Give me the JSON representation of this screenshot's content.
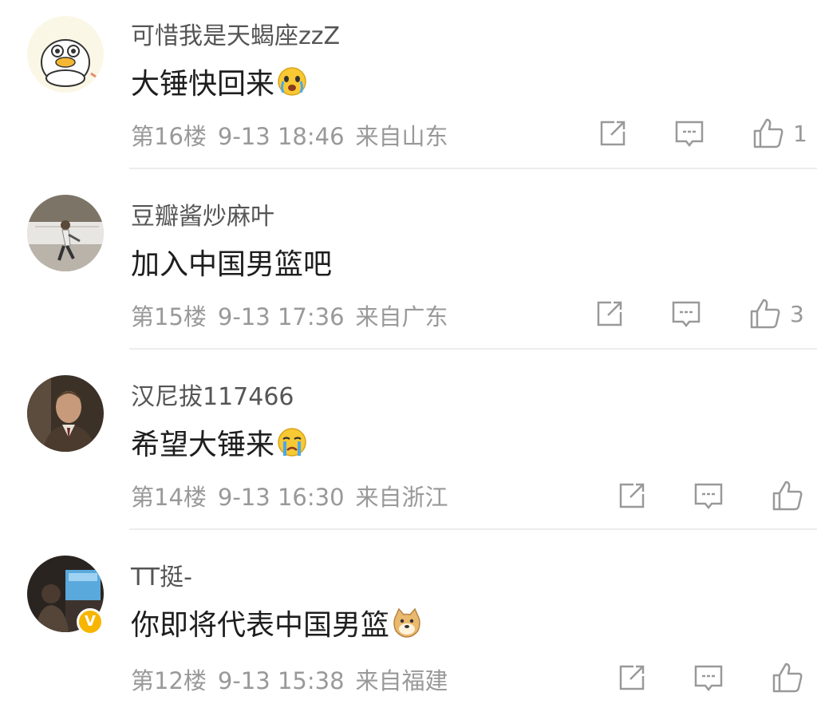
{
  "comments": [
    {
      "username": "可惜我是天蝎座zzZ",
      "content": "大锤快回来",
      "emoji": "crying-face-emoji",
      "floor": "第16楼",
      "time": "9-13 18:46",
      "location": "来自山东",
      "likes": "1",
      "avatar": "cartoon-duck-avatar"
    },
    {
      "username": "豆瓣酱炒麻叶",
      "content": "加入中国男篮吧",
      "emoji": "",
      "floor": "第15楼",
      "time": "9-13 17:36",
      "location": "来自广东",
      "likes": "3",
      "avatar": "basketball-court-avatar"
    },
    {
      "username": "汉尼拔117466",
      "content": "希望大锤来",
      "emoji": "tears-face-emoji",
      "floor": "第14楼",
      "time": "9-13 16:30",
      "location": "来自浙江",
      "likes": "",
      "avatar": "man-portrait-avatar"
    },
    {
      "username": "TT挺-",
      "content": "你即将代表中国男篮",
      "emoji": "doge-emoji",
      "floor": "第12楼",
      "time": "9-13 15:38",
      "location": "来自福建",
      "likes": "",
      "avatar": "arena-photo-avatar",
      "verified_badge": "V"
    }
  ],
  "icons": {
    "share": "share-icon",
    "reply": "comment-icon",
    "like": "thumbs-up-icon"
  },
  "colors": {
    "meta_text": "#999999",
    "username_text": "#555555",
    "divider": "#ececec",
    "verified_badge": "#f7b500"
  }
}
